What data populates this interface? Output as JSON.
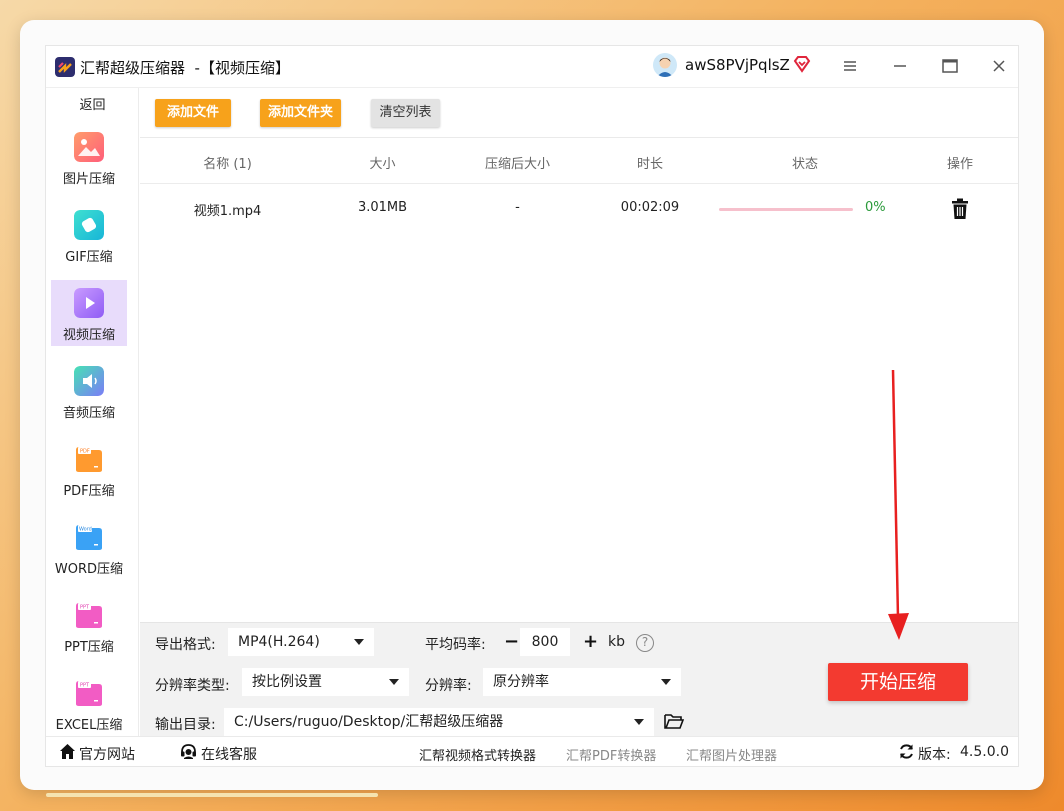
{
  "app": {
    "title": "汇帮超级压缩器  -【视频压缩】",
    "username": "awS8PVjPqlsZ"
  },
  "sidebar": {
    "back_label": "返回",
    "items": [
      {
        "label": "图片压缩",
        "icon": "image-icon"
      },
      {
        "label": "GIF压缩",
        "icon": "gif-icon"
      },
      {
        "label": "视频压缩",
        "icon": "video-icon"
      },
      {
        "label": "音频压缩",
        "icon": "audio-icon"
      },
      {
        "label": "PDF压缩",
        "icon": "pdf-icon"
      },
      {
        "label": "WORD压缩",
        "icon": "word-icon"
      },
      {
        "label": "PPT压缩",
        "icon": "ppt-icon"
      },
      {
        "label": "EXCEL压缩",
        "icon": "excel-icon"
      }
    ],
    "active_index": 2
  },
  "toolbar": {
    "add_file_label": "添加文件",
    "add_folder_label": "添加文件夹",
    "clear_list_label": "清空列表"
  },
  "table": {
    "headers": {
      "name": "名称 (1)",
      "size": "大小",
      "compressed_size": "压缩后大小",
      "duration": "时长",
      "status": "状态",
      "action": "操作"
    },
    "rows": [
      {
        "name": "视频1.mp4",
        "size": "3.01MB",
        "compressed_size": "-",
        "duration": "00:02:09",
        "progress_percent": 0,
        "progress_label": "0%"
      }
    ]
  },
  "settings": {
    "format_label": "导出格式:",
    "format_value": "MP4(H.264)",
    "bitrate_label": "平均码率:",
    "bitrate_minus": "−",
    "bitrate_value": "800",
    "bitrate_plus": "+",
    "bitrate_unit": "kb",
    "help_glyph": "?",
    "res_type_label": "分辨率类型:",
    "res_type_value": "按比例设置",
    "resolution_label": "分辨率:",
    "resolution_value": "原分辨率",
    "output_label": "输出目录:",
    "output_value": "C:/Users/ruguo/Desktop/汇帮超级压缩器",
    "start_label": "开始压缩"
  },
  "footer": {
    "website_label": "官方网站",
    "support_label": "在线客服",
    "links": [
      "汇帮视频格式转换器",
      "汇帮PDF转换器",
      "汇帮图片处理器"
    ],
    "version_label": "版本:",
    "version_value": "4.5.0.0"
  },
  "colors": {
    "orange_button": "#f7a21b",
    "start_button": "#f33a30",
    "active_nav": "#e8dcfb",
    "progress_text": "#2a9a3a"
  }
}
